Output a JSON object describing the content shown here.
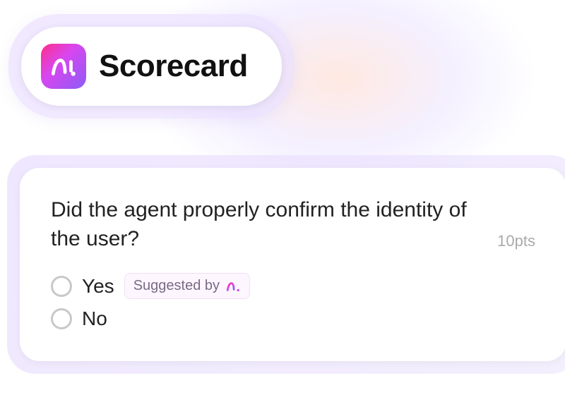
{
  "header": {
    "title": "Scorecard",
    "logo_name": "ai-logo"
  },
  "card": {
    "question": "Did the agent properly confirm the identity of the user?",
    "points_label": "10pts",
    "options": [
      {
        "label": "Yes",
        "suggested": true
      },
      {
        "label": "No",
        "suggested": false
      }
    ],
    "suggested_text": "Suggested by"
  },
  "colors": {
    "gradient_start": "#ff2d87",
    "gradient_mid": "#d946ef",
    "gradient_end": "#8b5cf6"
  }
}
